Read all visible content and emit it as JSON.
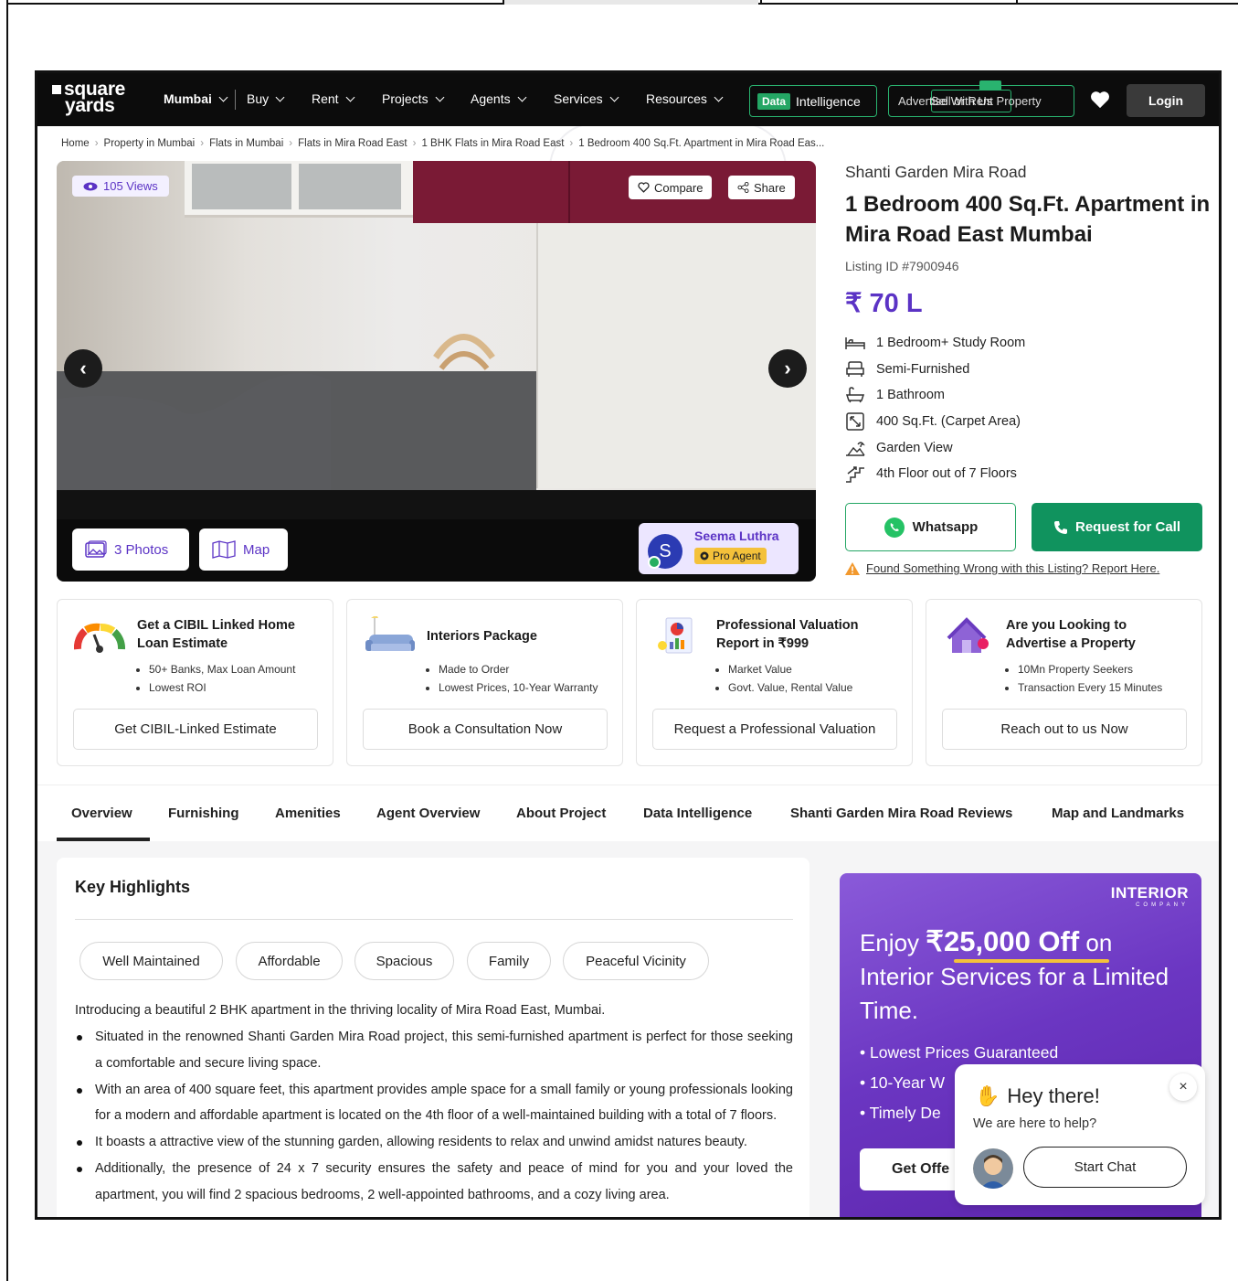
{
  "nav": {
    "logo_line1": "square",
    "logo_line2": "yards",
    "city": "Mumbai",
    "items": [
      "Buy",
      "Rent",
      "Projects",
      "Agents",
      "Services",
      "Resources"
    ],
    "data_badge": "Data",
    "data_label": "Intelligence",
    "advertise_label": "Advertise With Us",
    "sell_rent_label": "Sell or Rent Property",
    "login": "Login"
  },
  "breadcrumb": [
    "Home",
    "Property in Mumbai",
    "Flats in Mumbai",
    "Flats in Mira Road East",
    "1 BHK Flats in Mira Road East",
    "1 Bedroom 400 Sq.Ft. Apartment in Mira Road Eas..."
  ],
  "gallery": {
    "views": "105 Views",
    "compare": "Compare",
    "share": "Share",
    "photos": "3 Photos",
    "map": "Map",
    "agent_initial": "S",
    "agent_name": "Seema Luthra",
    "agent_badge": "Pro Agent"
  },
  "listing": {
    "project": "Shanti Garden Mira Road",
    "title": "1 Bedroom 400 Sq.Ft. Apartment in Mira Road East Mumbai",
    "listing_id": "Listing ID #7900946",
    "price": "₹ 70 L",
    "features": [
      {
        "icon": "bed-icon",
        "text": "1 Bedroom+ Study Room"
      },
      {
        "icon": "sofa-icon",
        "text": "Semi-Furnished"
      },
      {
        "icon": "bathtub-icon",
        "text": "1 Bathroom"
      },
      {
        "icon": "area-icon",
        "text": "400 Sq.Ft. (Carpet Area)"
      },
      {
        "icon": "garden-icon",
        "text": "Garden View"
      },
      {
        "icon": "floor-icon",
        "text": "4th Floor out of 7 Floors"
      }
    ],
    "whatsapp": "Whatsapp",
    "request_call": "Request for Call",
    "report": "Found Something Wrong with this Listing? Report Here."
  },
  "cards": [
    {
      "title": "Get a CIBIL Linked Home Loan Estimate",
      "bullets": [
        "50+ Banks, Max Loan Amount",
        "Lowest ROI"
      ],
      "button": "Get CIBIL-Linked Estimate"
    },
    {
      "title": "Interiors Package",
      "bullets": [
        "Made to Order",
        "Lowest Prices, 10-Year Warranty"
      ],
      "button": "Book a Consultation Now"
    },
    {
      "title": "Professional Valuation Report in ₹999",
      "bullets": [
        "Market Value",
        "Govt. Value, Rental Value"
      ],
      "button": "Request a Professional Valuation"
    },
    {
      "title": "Are you Looking to Advertise a Property",
      "bullets": [
        "10Mn Property Seekers",
        "Transaction Every 15 Minutes"
      ],
      "button": "Reach out to us Now"
    }
  ],
  "tabs": [
    "Overview",
    "Furnishing",
    "Amenities",
    "Agent Overview",
    "About Project",
    "Data Intelligence",
    "Shanti Garden Mira Road Reviews",
    "Map and Landmarks"
  ],
  "highlights": {
    "title": "Key Highlights",
    "chips": [
      "Well Maintained",
      "Affordable",
      "Spacious",
      "Family",
      "Peaceful Vicinity"
    ],
    "intro": "Introducing a beautiful 2 BHK apartment in the thriving locality of Mira Road East, Mumbai.",
    "points": [
      "Situated in the renowned Shanti Garden Mira Road project, this semi-furnished apartment is perfect for those seeking a comfortable and secure living space.",
      "With an area of 400 square feet, this apartment provides ample space for a small family or young professionals looking for a modern and affordable apartment is located on the 4th floor of a well-maintained building with a total of 7 floors.",
      "It boasts a attractive view of the stunning garden, allowing residents to relax and unwind amidst natures beauty.",
      "Additionally, the presence of 24 x 7 security ensures the safety and peace of mind for you and your loved the apartment, you will find 2 spacious bedrooms, 2 well-appointed bathrooms, and a cozy living area."
    ]
  },
  "ad": {
    "brand": "INTERIOR",
    "brand_sub": "COMPANY",
    "head_pre": "Enjoy ",
    "head_amount": "₹25,000 Off",
    "head_post": " on Interior Services for a Limited Time.",
    "bullets": [
      "• Lowest Prices Guaranteed",
      "• 10-Year W",
      "• Timely De"
    ],
    "button": "Get Offe"
  },
  "chat": {
    "hey": "Hey there!",
    "sub": "We are here to help?",
    "close": "×",
    "start": "Start Chat"
  }
}
